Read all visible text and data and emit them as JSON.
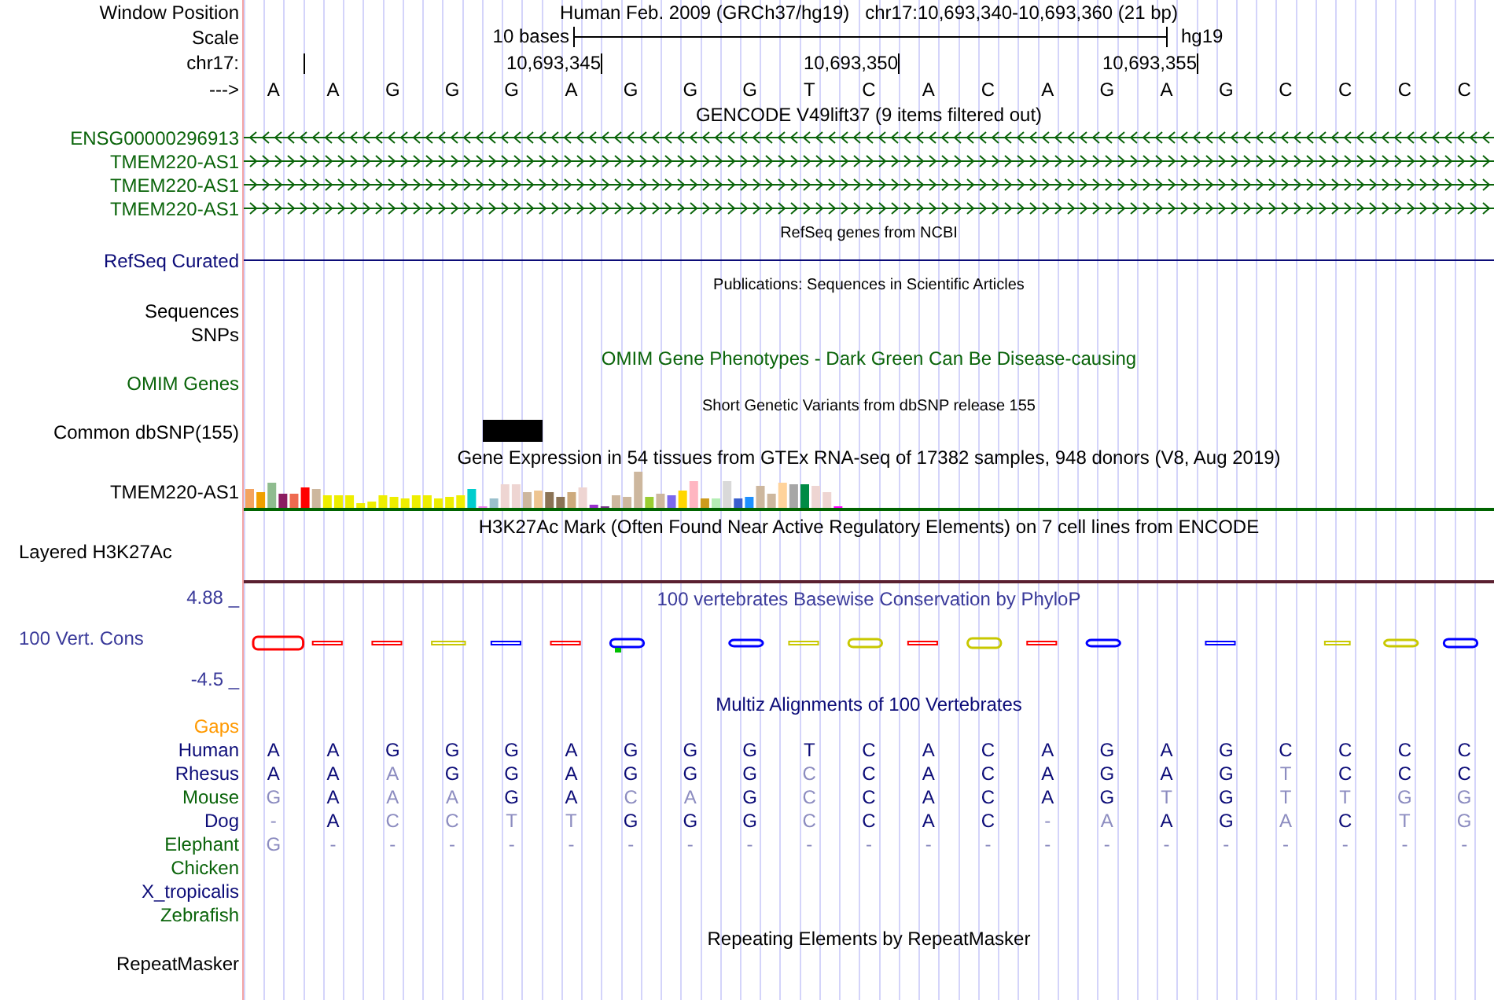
{
  "header": {
    "position_label": "Window Position",
    "position_text": "Human Feb. 2009 (GRCh37/hg19)   chr17:10,693,340-10,693,360 (21 bp)",
    "scale_label": "Scale",
    "scale_text": "10 bases",
    "assembly": "hg19",
    "chrom_label": "chr17:",
    "ticks": [
      "10,693,345",
      "10,693,350",
      "10,693,355"
    ],
    "strand_label": "--->",
    "bases": [
      "A",
      "A",
      "G",
      "G",
      "G",
      "A",
      "G",
      "G",
      "G",
      "T",
      "C",
      "A",
      "C",
      "A",
      "G",
      "A",
      "G",
      "C",
      "C",
      "C",
      "C"
    ]
  },
  "tracks": [
    {
      "kind": "genes",
      "title": "GENCODE V49lift37 (9 items filtered out)",
      "items": [
        {
          "label": "ENSG00000296913",
          "kind": "reverse"
        },
        {
          "label": "TMEM220-AS1",
          "kind": "forward"
        },
        {
          "label": "TMEM220-AS1",
          "kind": "forward"
        },
        {
          "label": "TMEM220-AS1",
          "kind": "forward"
        }
      ]
    },
    {
      "kind": "line",
      "title": "RefSeq genes from NCBI",
      "label": "RefSeq Curated"
    },
    {
      "kind": "labels",
      "title": "Publications: Sequences in Scientific Articles",
      "labels": [
        "Sequences",
        "SNPs"
      ]
    },
    {
      "kind": "omim",
      "title": "OMIM Gene Phenotypes - Dark Green Can Be Disease-causing",
      "label": "OMIM Genes"
    },
    {
      "kind": "snp",
      "title": "Short Genetic Variants from dbSNP release 155",
      "label": "Common dbSNP(155)"
    },
    {
      "kind": "expression",
      "title": "Gene Expression in 54 tissues from GTEx RNA-seq of 17382 samples, 948 donors (V8, Aug 2019)",
      "label": "TMEM220-AS1"
    },
    {
      "kind": "signal",
      "title": "H3K27Ac Mark (Often Found Near Active Regulatory Elements) on 7 cell lines from ENCODE",
      "label": "Layered H3K27Ac"
    },
    {
      "kind": "conservation",
      "title": "100 vertebrates Basewise Conservation by PhyloP",
      "label": "100 Vert. Cons",
      "max": "4.88 _",
      "min": "-4.5 _"
    },
    {
      "kind": "alignment",
      "title": "Multiz Alignments of 100 Vertebrates",
      "gaps_label": "Gaps",
      "species": [
        {
          "name": "Human",
          "color": "#0c0c78",
          "bases": [
            {
              "b": "A",
              "match": true
            },
            {
              "b": "A",
              "match": true
            },
            {
              "b": "G",
              "match": true
            },
            {
              "b": "G",
              "match": true
            },
            {
              "b": "G",
              "match": true
            },
            {
              "b": "A",
              "match": true
            },
            {
              "b": "G",
              "match": true
            },
            {
              "b": "G",
              "match": true
            },
            {
              "b": "G",
              "match": true
            },
            {
              "b": "T",
              "match": true
            },
            {
              "b": "C",
              "match": true
            },
            {
              "b": "A",
              "match": true
            },
            {
              "b": "C",
              "match": true
            },
            {
              "b": "A",
              "match": true
            },
            {
              "b": "G",
              "match": true
            },
            {
              "b": "A",
              "match": true
            },
            {
              "b": "G",
              "match": true
            },
            {
              "b": "C",
              "match": true
            },
            {
              "b": "C",
              "match": true
            },
            {
              "b": "C",
              "match": true
            },
            {
              "b": "C",
              "match": true
            }
          ]
        },
        {
          "name": "Rhesus",
          "color": "#0c0c78",
          "bases": [
            {
              "b": "A",
              "match": true
            },
            {
              "b": "A",
              "match": true
            },
            {
              "b": "A",
              "match": false
            },
            {
              "b": "G",
              "match": true
            },
            {
              "b": "G",
              "match": true
            },
            {
              "b": "A",
              "match": true
            },
            {
              "b": "G",
              "match": true
            },
            {
              "b": "G",
              "match": true
            },
            {
              "b": "G",
              "match": true
            },
            {
              "b": "C",
              "match": false
            },
            {
              "b": "C",
              "match": true
            },
            {
              "b": "A",
              "match": true
            },
            {
              "b": "C",
              "match": true
            },
            {
              "b": "A",
              "match": true
            },
            {
              "b": "G",
              "match": true
            },
            {
              "b": "A",
              "match": true
            },
            {
              "b": "G",
              "match": true
            },
            {
              "b": "T",
              "match": false
            },
            {
              "b": "C",
              "match": true
            },
            {
              "b": "C",
              "match": true
            },
            {
              "b": "C",
              "match": true
            }
          ]
        },
        {
          "name": "Mouse",
          "color": "#0a640a",
          "bases": [
            {
              "b": "G",
              "match": false
            },
            {
              "b": "A",
              "match": true
            },
            {
              "b": "A",
              "match": false
            },
            {
              "b": "A",
              "match": false
            },
            {
              "b": "G",
              "match": true
            },
            {
              "b": "A",
              "match": true
            },
            {
              "b": "C",
              "match": false
            },
            {
              "b": "A",
              "match": false
            },
            {
              "b": "G",
              "match": true
            },
            {
              "b": "C",
              "match": false
            },
            {
              "b": "C",
              "match": true
            },
            {
              "b": "A",
              "match": true
            },
            {
              "b": "C",
              "match": true
            },
            {
              "b": "A",
              "match": true
            },
            {
              "b": "G",
              "match": true
            },
            {
              "b": "T",
              "match": false
            },
            {
              "b": "G",
              "match": true
            },
            {
              "b": "T",
              "match": false
            },
            {
              "b": "T",
              "match": false
            },
            {
              "b": "G",
              "match": false
            },
            {
              "b": "G",
              "match": false
            }
          ]
        },
        {
          "name": "Dog",
          "color": "#0c0c78",
          "bases": [
            {
              "b": "-",
              "match": false
            },
            {
              "b": "A",
              "match": true
            },
            {
              "b": "C",
              "match": false
            },
            {
              "b": "C",
              "match": false
            },
            {
              "b": "T",
              "match": false
            },
            {
              "b": "T",
              "match": false
            },
            {
              "b": "G",
              "match": true
            },
            {
              "b": "G",
              "match": true
            },
            {
              "b": "G",
              "match": true
            },
            {
              "b": "C",
              "match": false
            },
            {
              "b": "C",
              "match": true
            },
            {
              "b": "A",
              "match": true
            },
            {
              "b": "C",
              "match": true
            },
            {
              "b": "-",
              "match": false
            },
            {
              "b": "A",
              "match": false
            },
            {
              "b": "A",
              "match": true
            },
            {
              "b": "G",
              "match": true
            },
            {
              "b": "A",
              "match": false
            },
            {
              "b": "C",
              "match": true
            },
            {
              "b": "T",
              "match": false
            },
            {
              "b": "G",
              "match": false
            }
          ]
        },
        {
          "name": "Elephant",
          "color": "#0a640a",
          "bases": [
            {
              "b": "G",
              "match": false
            },
            {
              "b": "-",
              "match": false
            },
            {
              "b": "-",
              "match": false
            },
            {
              "b": "-",
              "match": false
            },
            {
              "b": "-",
              "match": false
            },
            {
              "b": "-",
              "match": false
            },
            {
              "b": "-",
              "match": false
            },
            {
              "b": "-",
              "match": false
            },
            {
              "b": "-",
              "match": false
            },
            {
              "b": "-",
              "match": false
            },
            {
              "b": "-",
              "match": false
            },
            {
              "b": "-",
              "match": false
            },
            {
              "b": "-",
              "match": false
            },
            {
              "b": "-",
              "match": false
            },
            {
              "b": "-",
              "match": false
            },
            {
              "b": "-",
              "match": false
            },
            {
              "b": "-",
              "match": false
            },
            {
              "b": "-",
              "match": false
            },
            {
              "b": "-",
              "match": false
            },
            {
              "b": "-",
              "match": false
            },
            {
              "b": "-",
              "match": false
            }
          ]
        },
        {
          "name": "Chicken",
          "color": "#0a640a"
        },
        {
          "name": "X_tropicalis",
          "color": "#0c0c78"
        },
        {
          "name": "Zebrafish",
          "color": "#0a640a"
        }
      ]
    },
    {
      "kind": "repeats",
      "title": "Repeating Elements by RepeatMasker",
      "label": "RepeatMasker"
    }
  ]
}
